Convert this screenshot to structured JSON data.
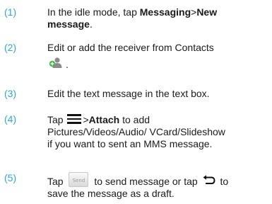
{
  "steps": [
    {
      "num": "(1)",
      "text_a": "In the idle mode, tap ",
      "bold_a": "Messaging",
      "sep": ">",
      "bold_b": "New",
      "bold_c": "message",
      "text_end": "."
    },
    {
      "num": "(2)",
      "text_a": "Edit or add the receiver from Contacts",
      "icon": "add-contact-icon",
      "text_end": "."
    },
    {
      "num": "(3)",
      "text_a": "Edit the text message in the text box."
    },
    {
      "num": "(4)",
      "text_a": "Tap ",
      "icon": "menu-icon",
      "sep": ">",
      "bold_a": "Attach",
      "text_b": " to add",
      "line2": "Pictures/Videos/Audio/ VCard/Slideshow",
      "line3": "if you want to sent an MMS message."
    },
    {
      "num": "(5)",
      "text_a": "Tap ",
      "send_label": "Send",
      "text_b": " to send message or tap ",
      "icon": "back-icon",
      "text_c": " to",
      "line2": "save the message as a draft."
    }
  ],
  "colors": {
    "number": "#2fa7d8",
    "text": "#1a1a1a"
  }
}
